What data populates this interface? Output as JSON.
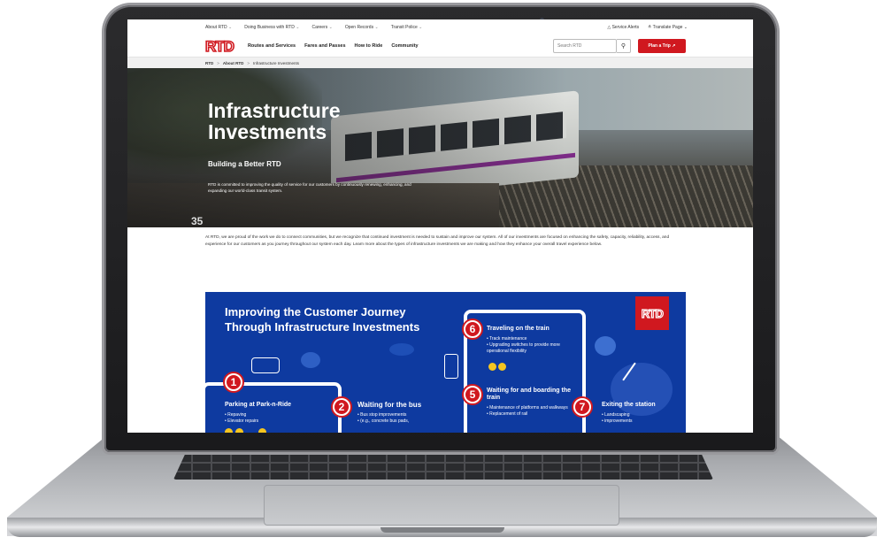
{
  "utility_nav": {
    "items": [
      "About RTD",
      "Doing Business with RTD",
      "Careers",
      "Open Records",
      "Transit Police"
    ],
    "service_alerts": "Service Alerts",
    "translate": "Translate Page"
  },
  "main_nav": {
    "logo": "RTD",
    "items": [
      "Routes and Services",
      "Fares and Passes",
      "How to Ride",
      "Community"
    ],
    "search_placeholder": "Search RTD",
    "plan_trip": "Plan a Trip"
  },
  "breadcrumb": [
    "RTD",
    "About RTD",
    "Infrastructure Investments"
  ],
  "hero": {
    "title": "Infrastructure Investments",
    "subtitle": "Building a Better RTD",
    "description": "RTD is committed to improving the quality of service for our customers by continuously renewing, enhancing, and expanding our world-class transit system."
  },
  "intro": "At RTD, we are proud of the work we do to connect communities, but we recognize that continued investment is needed to sustain and improve our system. All of our investments are focused on enhancing the safety, capacity, reliability, access, and experience for our customers as you journey throughout our system each day. Learn more about the types of infrastructure investments we are making and how they enhance your overall travel experience below.",
  "infographic": {
    "title": "Improving the Customer Journey Through Infrastructure Investments",
    "logo": "RTD",
    "steps": [
      {
        "num": "1",
        "title": "Parking at Park-n-Ride",
        "items": [
          "Repaving",
          "Elevator repairs"
        ]
      },
      {
        "num": "2",
        "title": "Waiting for the bus",
        "items": [
          "Bus stop improvements",
          "(e.g., concrete bus pads,"
        ]
      },
      {
        "num": "5",
        "title": "Waiting for and boarding the train",
        "items": [
          "Maintenance of platforms and walkways",
          "Replacement of rail"
        ]
      },
      {
        "num": "6",
        "title": "Traveling on the train",
        "items": [
          "Track maintenance",
          "Upgrading switches to provide more operational flexibility"
        ]
      },
      {
        "num": "7",
        "title": "Exiting the station",
        "items": [
          "Landscaping",
          "improvements"
        ]
      }
    ],
    "colors": {
      "blue": "#0e3aa0",
      "red": "#d0181f",
      "yellow": "#f5c520"
    }
  },
  "hero_sign": "35"
}
